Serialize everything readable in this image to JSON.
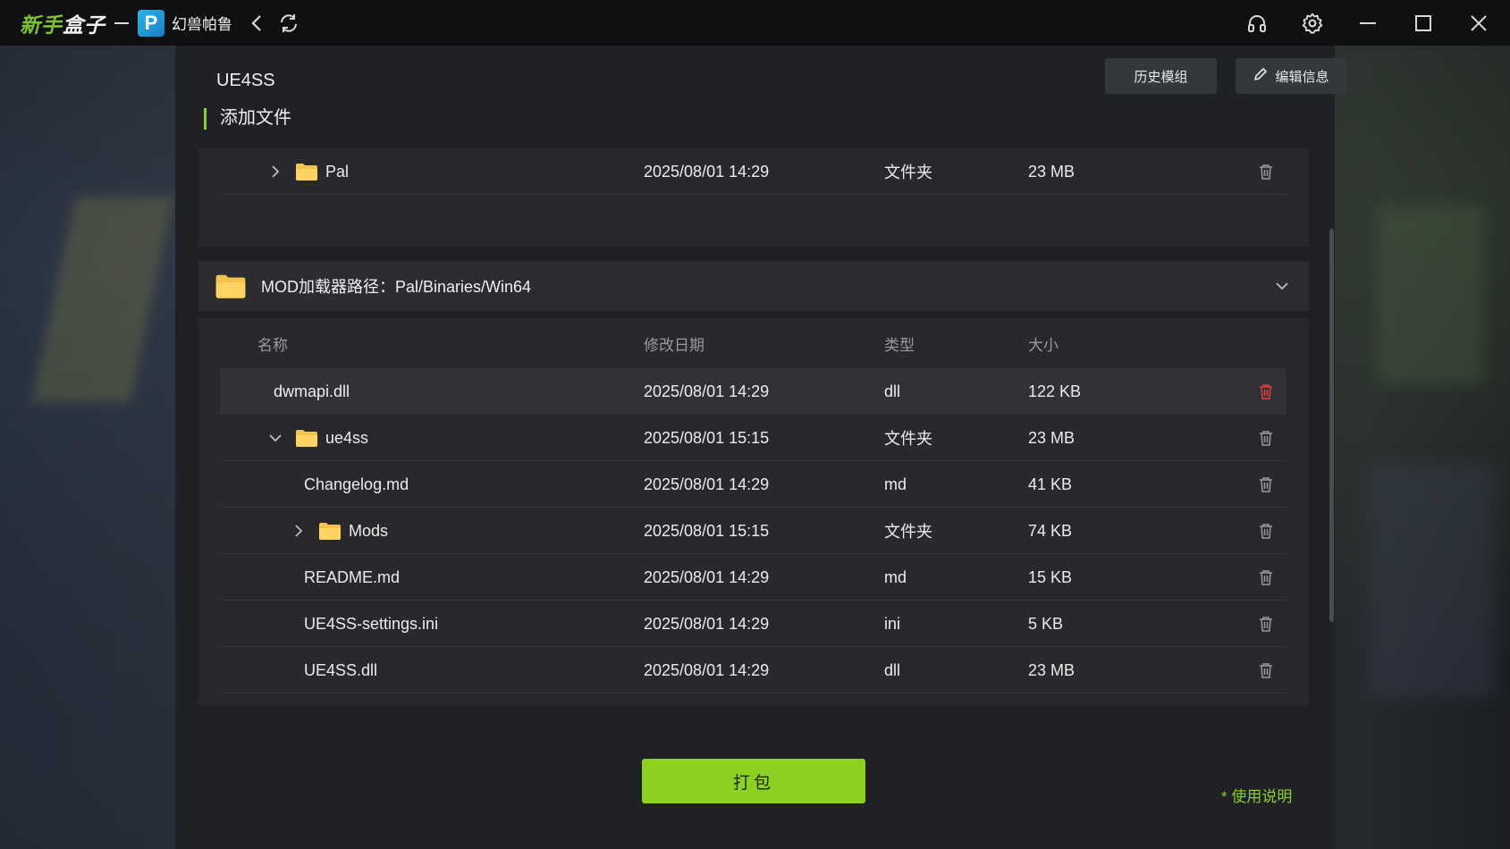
{
  "titlebar": {
    "brand_left": "新手",
    "brand_right": "盒子",
    "game_badge": "P",
    "game_name": "幻兽帕鲁",
    "icons": [
      "chevron-left-icon",
      "refresh-icon",
      "headset-icon",
      "gear-icon",
      "minimize-icon",
      "maximize-icon",
      "close-icon"
    ]
  },
  "header": {
    "mod_title": "UE4SS",
    "history_label": "历史模组",
    "edit_label": "编辑信息"
  },
  "section": {
    "title": "添加文件"
  },
  "top_list": [
    {
      "name": "Pal",
      "date": "2025/08/01 14:29",
      "type": "文件夹",
      "size": "23 MB",
      "kind": "folder",
      "expanded": false
    }
  ],
  "group": {
    "label": "MOD加载器路径：Pal/Binaries/Win64",
    "columns": {
      "name": "名称",
      "date": "修改日期",
      "type": "类型",
      "size": "大小"
    },
    "rows": [
      {
        "name": "dwmapi.dll",
        "date": "2025/08/01 14:29",
        "type": "dll",
        "size": "122 KB"
      },
      {
        "name": "ue4ss",
        "date": "2025/08/01 15:15",
        "type": "文件夹",
        "size": "23 MB"
      },
      {
        "name": "Changelog.md",
        "date": "2025/08/01 14:29",
        "type": "md",
        "size": "41 KB"
      },
      {
        "name": "Mods",
        "date": "2025/08/01 15:15",
        "type": "文件夹",
        "size": "74 KB"
      },
      {
        "name": "README.md",
        "date": "2025/08/01 14:29",
        "type": "md",
        "size": "15 KB"
      },
      {
        "name": "UE4SS-settings.ini",
        "date": "2025/08/01 14:29",
        "type": "ini",
        "size": "5 KB"
      },
      {
        "name": "UE4SS.dll",
        "date": "2025/08/01 14:29",
        "type": "dll",
        "size": "23 MB"
      }
    ]
  },
  "footer": {
    "pack_label": "打包",
    "usage_label": "* 使用说明"
  },
  "colors": {
    "accent": "#8cd11f",
    "delete_active": "#e0403a",
    "delete_idle": "#9a9a9a",
    "folder": "#f5c24a"
  }
}
